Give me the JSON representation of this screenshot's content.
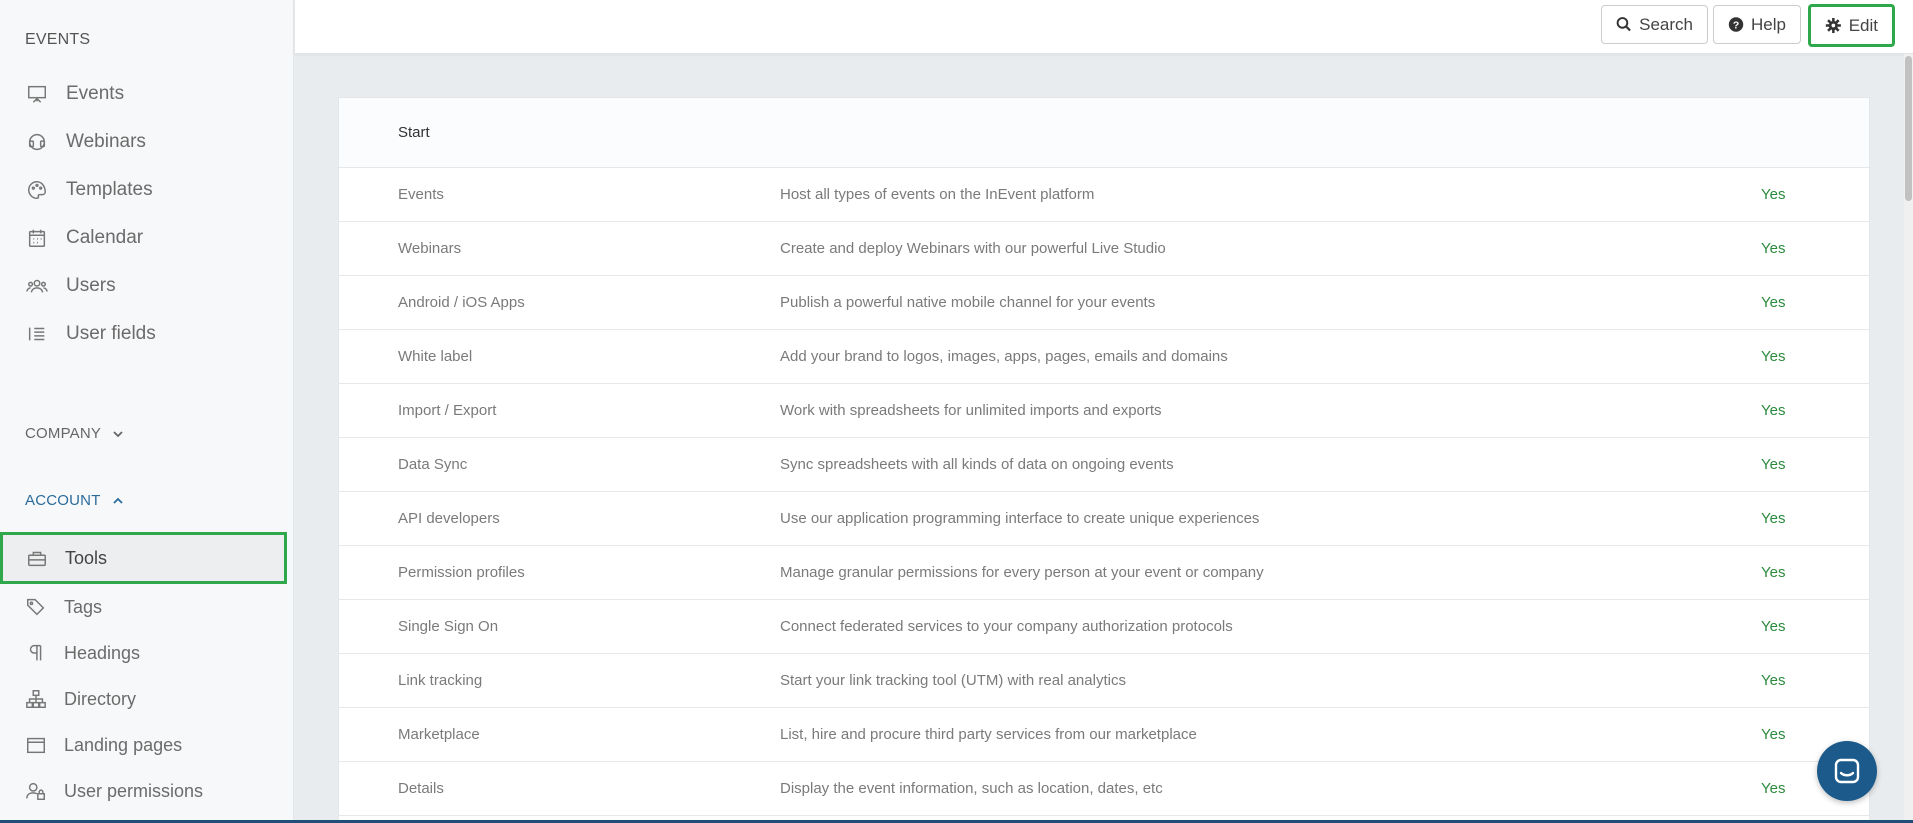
{
  "sidebar": {
    "events_header": "EVENTS",
    "events_items": [
      {
        "label": "Events",
        "icon": "presentation-icon"
      },
      {
        "label": "Webinars",
        "icon": "headset-icon"
      },
      {
        "label": "Templates",
        "icon": "palette-icon"
      },
      {
        "label": "Calendar",
        "icon": "calendar-icon"
      },
      {
        "label": "Users",
        "icon": "users-icon"
      },
      {
        "label": "User fields",
        "icon": "list-icon"
      }
    ],
    "company_header": "COMPANY",
    "account_header": "ACCOUNT",
    "account_items": [
      {
        "label": "Tools",
        "icon": "toolbox-icon",
        "active": true
      },
      {
        "label": "Tags",
        "icon": "tags-icon"
      },
      {
        "label": "Headings",
        "icon": "paragraph-icon"
      },
      {
        "label": "Directory",
        "icon": "sitemap-icon"
      },
      {
        "label": "Landing pages",
        "icon": "window-icon"
      },
      {
        "label": "User permissions",
        "icon": "user-lock-icon"
      }
    ]
  },
  "topbar": {
    "search_label": "Search",
    "help_label": "Help",
    "edit_label": "Edit"
  },
  "table": {
    "header": "Start",
    "rows": [
      {
        "name": "Events",
        "description": "Host all types of events on the InEvent platform",
        "status": "Yes"
      },
      {
        "name": "Webinars",
        "description": "Create and deploy Webinars with our powerful Live Studio",
        "status": "Yes"
      },
      {
        "name": "Android / iOS Apps",
        "description": "Publish a powerful native mobile channel for your events",
        "status": "Yes"
      },
      {
        "name": "White label",
        "description": "Add your brand to logos, images, apps, pages, emails and domains",
        "status": "Yes"
      },
      {
        "name": "Import / Export",
        "description": "Work with spreadsheets for unlimited imports and exports",
        "status": "Yes"
      },
      {
        "name": "Data Sync",
        "description": "Sync spreadsheets with all kinds of data on ongoing events",
        "status": "Yes"
      },
      {
        "name": "API developers",
        "description": "Use our application programming interface to create unique experiences",
        "status": "Yes"
      },
      {
        "name": "Permission profiles",
        "description": "Manage granular permissions for every person at your event or company",
        "status": "Yes"
      },
      {
        "name": "Single Sign On",
        "description": "Connect federated services to your company authorization protocols",
        "status": "Yes"
      },
      {
        "name": "Link tracking",
        "description": "Start your link tracking tool (UTM) with real analytics",
        "status": "Yes"
      },
      {
        "name": "Marketplace",
        "description": "List, hire and procure third party services from our marketplace",
        "status": "Yes"
      },
      {
        "name": "Details",
        "description": "Display the event information, such as location, dates, etc",
        "status": "Yes"
      }
    ]
  },
  "colors": {
    "accent_green": "#2ea84a",
    "yes_green": "#2c8a3e",
    "account_blue": "#2a6b9a",
    "chat_blue": "#1b5a8a"
  }
}
